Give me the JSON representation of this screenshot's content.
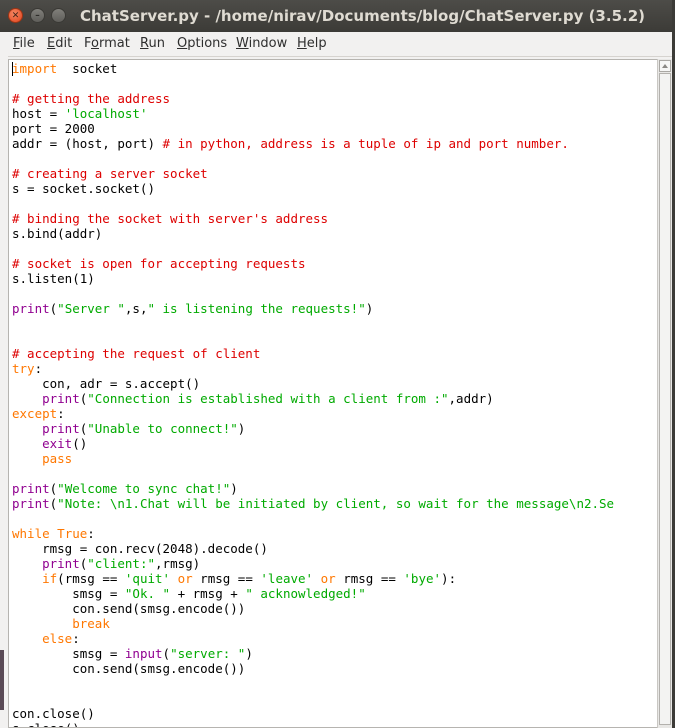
{
  "window": {
    "title": "ChatServer.py - /home/nirav/Documents/blog/ChatServer.py (3.5.2)"
  },
  "titlebar": {
    "close_glyph": "✕",
    "minimize_glyph": "–",
    "maximize_glyph": ""
  },
  "menubar": {
    "items": [
      {
        "mnemonic": "F",
        "rest": "ile"
      },
      {
        "mnemonic": "E",
        "rest": "dit"
      },
      {
        "pre": "F",
        "mnemonic": "o",
        "rest": "rmat"
      },
      {
        "mnemonic": "R",
        "rest": "un"
      },
      {
        "mnemonic": "O",
        "rest": "ptions"
      },
      {
        "mnemonic": "W",
        "rest": "indow"
      },
      {
        "mnemonic": "H",
        "rest": "elp"
      }
    ]
  },
  "editor": {
    "lines": [
      [
        [
          "kw",
          "import"
        ],
        [
          "",
          "  socket"
        ]
      ],
      [],
      [
        [
          "cm",
          "# getting the address"
        ]
      ],
      [
        [
          "",
          "host = "
        ],
        [
          "str",
          "'localhost'"
        ]
      ],
      [
        [
          "",
          "port = 2000"
        ]
      ],
      [
        [
          "",
          "addr = (host, port) "
        ],
        [
          "cm",
          "# in python, address is a tuple of ip and port number."
        ]
      ],
      [],
      [
        [
          "cm",
          "# creating a server socket"
        ]
      ],
      [
        [
          "",
          "s = socket.socket()"
        ]
      ],
      [],
      [
        [
          "cm",
          "# binding the socket with server's address"
        ]
      ],
      [
        [
          "",
          "s.bind(addr)"
        ]
      ],
      [],
      [
        [
          "cm",
          "# socket is open for accepting requests"
        ]
      ],
      [
        [
          "",
          "s.listen(1)"
        ]
      ],
      [],
      [
        [
          "bi",
          "print"
        ],
        [
          "",
          "("
        ],
        [
          "str",
          "\"Server \""
        ],
        [
          "",
          ",s,"
        ],
        [
          "str",
          "\" is listening the requests!\""
        ],
        [
          "",
          ")"
        ]
      ],
      [],
      [],
      [
        [
          "cm",
          "# accepting the request of client"
        ]
      ],
      [
        [
          "kw",
          "try"
        ],
        [
          "",
          ":"
        ]
      ],
      [
        [
          "",
          "    con, adr = s.accept()"
        ]
      ],
      [
        [
          "",
          "    "
        ],
        [
          "bi",
          "print"
        ],
        [
          "",
          "("
        ],
        [
          "str",
          "\"Connection is established with a client from :\""
        ],
        [
          "",
          ",addr)"
        ]
      ],
      [
        [
          "kw",
          "except"
        ],
        [
          "",
          ":"
        ]
      ],
      [
        [
          "",
          "    "
        ],
        [
          "bi",
          "print"
        ],
        [
          "",
          "("
        ],
        [
          "str",
          "\"Unable to connect!\""
        ],
        [
          "",
          ")"
        ]
      ],
      [
        [
          "",
          "    "
        ],
        [
          "bi",
          "exit"
        ],
        [
          "",
          "()"
        ]
      ],
      [
        [
          "",
          "    "
        ],
        [
          "kw",
          "pass"
        ]
      ],
      [],
      [
        [
          "bi",
          "print"
        ],
        [
          "",
          "("
        ],
        [
          "str",
          "\"Welcome to sync chat!\""
        ],
        [
          "",
          ")"
        ]
      ],
      [
        [
          "bi",
          "print"
        ],
        [
          "",
          "("
        ],
        [
          "str",
          "\"Note: \\n1.Chat will be initiated by client, so wait for the message\\n2.Se"
        ]
      ],
      [],
      [
        [
          "kw",
          "while"
        ],
        [
          "",
          " "
        ],
        [
          "kw",
          "True"
        ],
        [
          "",
          ":"
        ]
      ],
      [
        [
          "",
          "    rmsg = con.recv(2048).decode()"
        ]
      ],
      [
        [
          "",
          "    "
        ],
        [
          "bi",
          "print"
        ],
        [
          "",
          "("
        ],
        [
          "str",
          "\"client:\""
        ],
        [
          "",
          ",rmsg)"
        ]
      ],
      [
        [
          "",
          "    "
        ],
        [
          "kw",
          "if"
        ],
        [
          "",
          "(rmsg == "
        ],
        [
          "str",
          "'quit'"
        ],
        [
          "",
          " "
        ],
        [
          "kw",
          "or"
        ],
        [
          "",
          " rmsg == "
        ],
        [
          "str",
          "'leave'"
        ],
        [
          "",
          " "
        ],
        [
          "kw",
          "or"
        ],
        [
          "",
          " rmsg == "
        ],
        [
          "str",
          "'bye'"
        ],
        [
          "",
          "):"
        ]
      ],
      [
        [
          "",
          "        smsg = "
        ],
        [
          "str",
          "\"Ok. \""
        ],
        [
          "",
          " + rmsg + "
        ],
        [
          "str",
          "\" acknowledged!\""
        ]
      ],
      [
        [
          "",
          "        con.send(smsg.encode())"
        ]
      ],
      [
        [
          "",
          "        "
        ],
        [
          "kw",
          "break"
        ]
      ],
      [
        [
          "",
          "    "
        ],
        [
          "kw",
          "else"
        ],
        [
          "",
          ":"
        ]
      ],
      [
        [
          "",
          "        smsg = "
        ],
        [
          "bi",
          "input"
        ],
        [
          "",
          "("
        ],
        [
          "str",
          "\"server: \""
        ],
        [
          "",
          ")"
        ]
      ],
      [
        [
          "",
          "        con.send(smsg.encode())"
        ]
      ],
      [],
      [],
      [
        [
          "",
          "con.close()"
        ]
      ],
      [
        [
          "",
          "s.close()"
        ]
      ]
    ]
  },
  "colors": {
    "keyword": "#ff7700",
    "builtin": "#900090",
    "string": "#00aa00",
    "comment": "#dd0000",
    "titlebar": "#3c3b37",
    "close_button": "#e0421c"
  }
}
